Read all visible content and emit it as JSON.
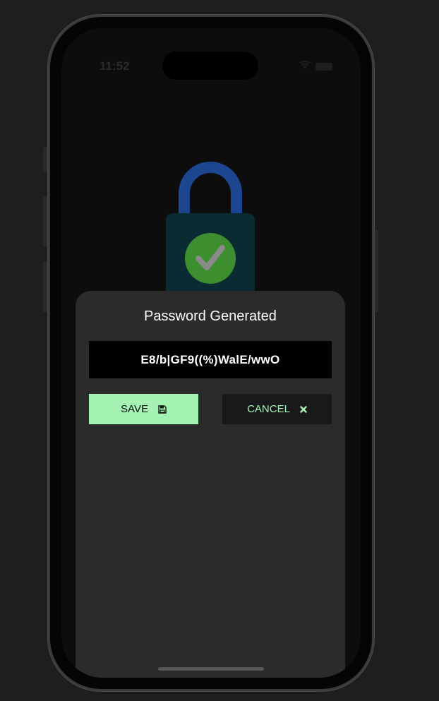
{
  "status_bar": {
    "time": "11:52"
  },
  "dialog": {
    "title": "Password Generated",
    "password": "E8/b|GF9((%)WalE/wwO",
    "save_label": "SAVE",
    "cancel_label": "CANCEL"
  },
  "icons": {
    "lock": "lock-check-icon",
    "save": "floppy-disk-icon",
    "cancel": "x-icon",
    "wifi": "wifi-icon",
    "battery": "battery-icon"
  },
  "colors": {
    "accent_green": "#a4f3b2",
    "lock_shackle": "#1d4690",
    "lock_body": "#0b2b33",
    "check_circle": "#3d8e2e",
    "sheet_background": "#2b2b2b"
  }
}
